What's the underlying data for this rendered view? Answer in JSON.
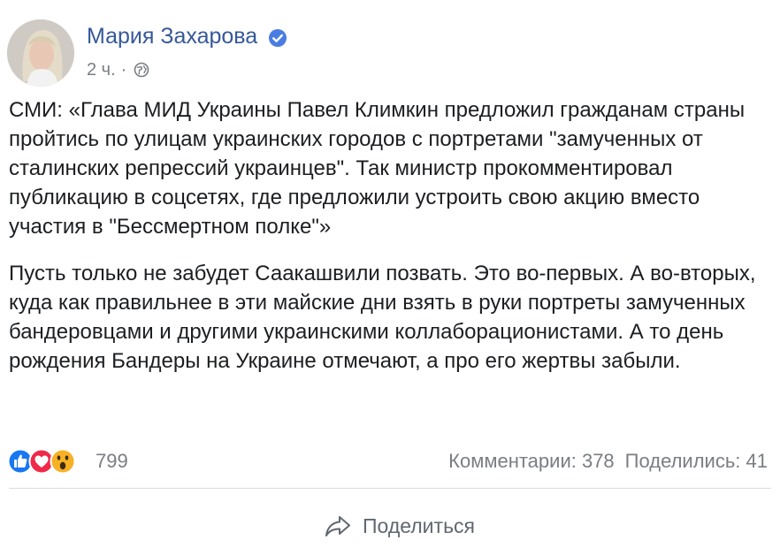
{
  "post": {
    "author": "Мария Захарова",
    "timestamp": "2 ч.",
    "separator": "·",
    "privacy_icon": "globe-icon",
    "verified_icon": "verified-badge-icon",
    "paragraphs": [
      "СМИ: «Глава МИД Украины Павел Климкин предложил гражданам страны пройтись по улицам украинских городов с портретами \"замученных от сталинских репрессий украинцев\". Так министр прокомментировал публикацию в соцсетях, где предложили устроить свою акцию вместо участия в \"Бессмертном полке\"»",
      "Пусть только не забудет Саакашвили позвать. Это во-первых. А во-вторых, куда как правильнее в эти майские дни взять в руки портреты замученных бандеровцами и другими украинскими коллаборационистами. А то день рождения Бандеры на Украине отмечают, а про его жертвы забыли."
    ]
  },
  "reactions": {
    "icons": [
      "like-icon",
      "love-icon",
      "wow-icon"
    ],
    "count": "799"
  },
  "stats": {
    "comments": "Комментарии: 378",
    "shares": "Поделились: 41"
  },
  "actions": {
    "share_label": "Поделиться",
    "share_icon": "share-arrow-icon"
  },
  "colors": {
    "author_link": "#365899",
    "meta_text": "#7a7d82",
    "like": "#1877f2",
    "love": "#f0284a",
    "wow": "#f7b125",
    "verified": "#4a7de2"
  }
}
